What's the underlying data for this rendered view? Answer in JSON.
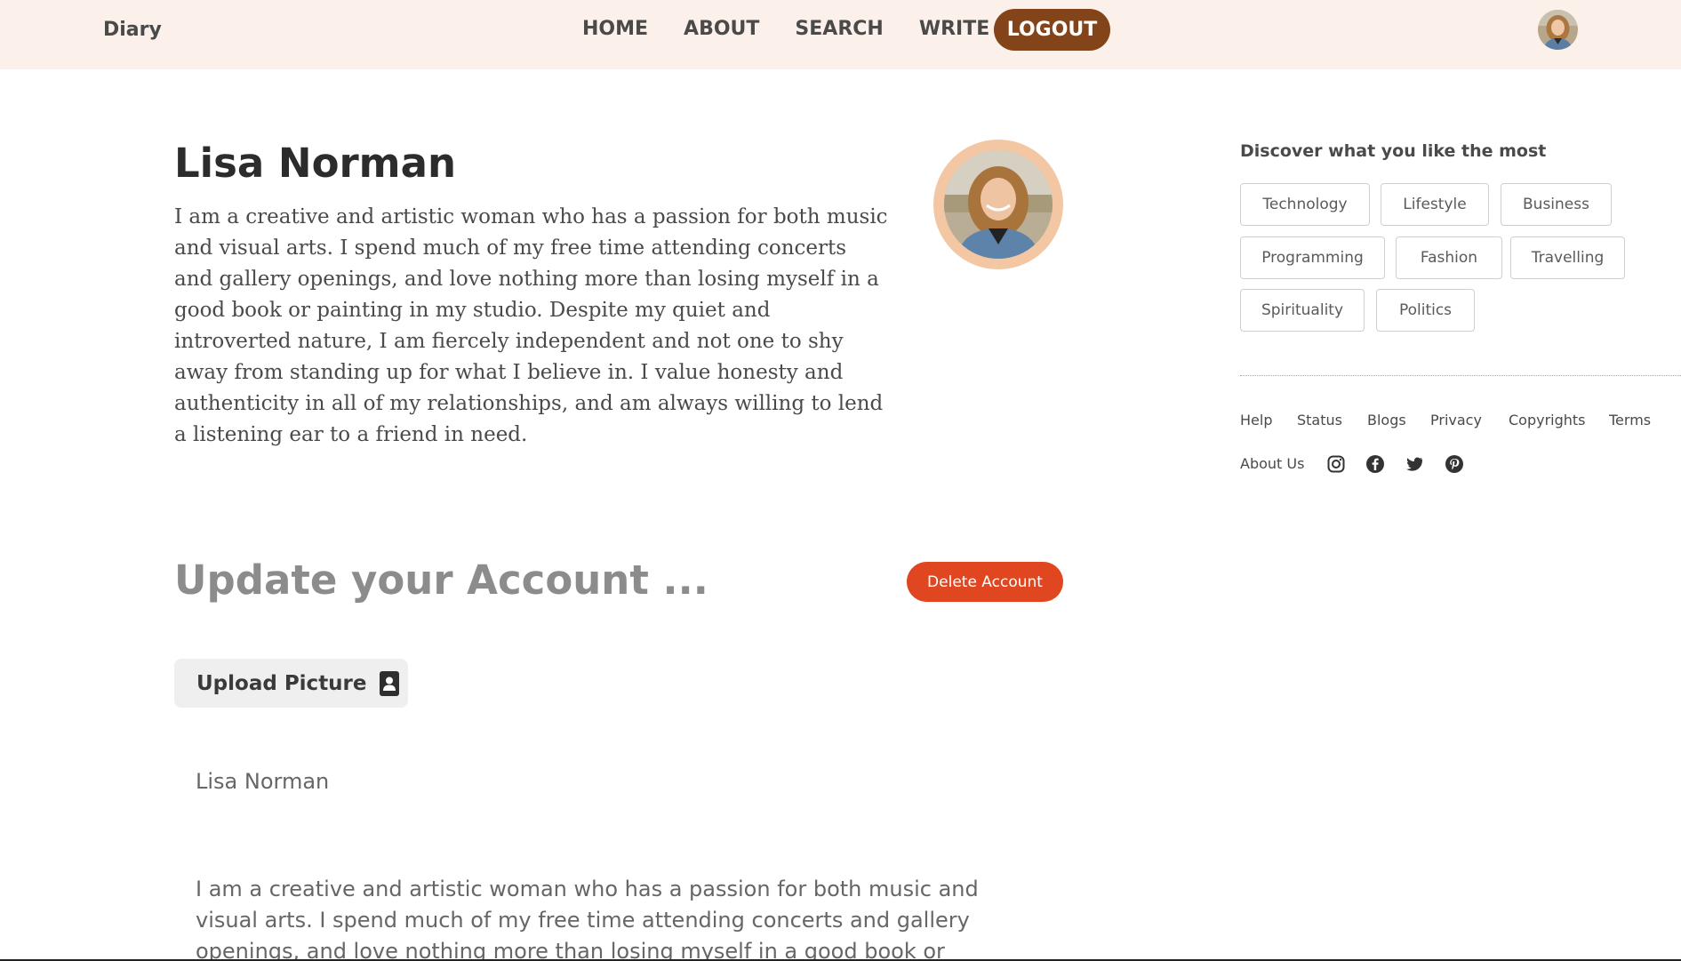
{
  "header": {
    "brand": "Diary",
    "nav": [
      "HOME",
      "ABOUT",
      "SEARCH",
      "WRITE"
    ],
    "logout_label": "LOGOUT",
    "accent_color": "#84441a",
    "background_color": "#fcf1ea"
  },
  "profile": {
    "name": "Lisa Norman",
    "bio": "I am a creative and artistic woman who has a passion for both music and visual arts. I spend much of my free time attending concerts and gallery openings, and love nothing more than losing myself in a good book or painting in my studio. Despite my quiet and introverted nature, I am fiercely independent and not one to shy away from standing up for what I believe in. I value honesty and authenticity in all of my relationships, and am always willing to lend a listening ear to a friend in need."
  },
  "update": {
    "title": "Update your Account ...",
    "delete_label": "Delete Account",
    "delete_color": "#e04721",
    "upload_label": "Upload Picture",
    "upload_icon": "contact-card-icon",
    "name_value": "Lisa Norman",
    "bio_value": "I am a creative and artistic woman who has a passion for both music and visual arts. I spend much of my free time attending concerts and gallery openings, and love nothing more than losing myself in a good book or painting in my studio."
  },
  "sidebar": {
    "title": "Discover what you like the most",
    "tags": [
      "Technology",
      "Lifestyle",
      "Business",
      "Programming",
      "Fashion",
      "Travelling",
      "Spirituality",
      "Politics"
    ],
    "footer_links": [
      "Help",
      "Status",
      "Blogs",
      "Privacy",
      "Copyrights",
      "Terms",
      "About Us"
    ],
    "social_icons": [
      "instagram-icon",
      "facebook-icon",
      "twitter-icon",
      "pinterest-icon"
    ]
  }
}
